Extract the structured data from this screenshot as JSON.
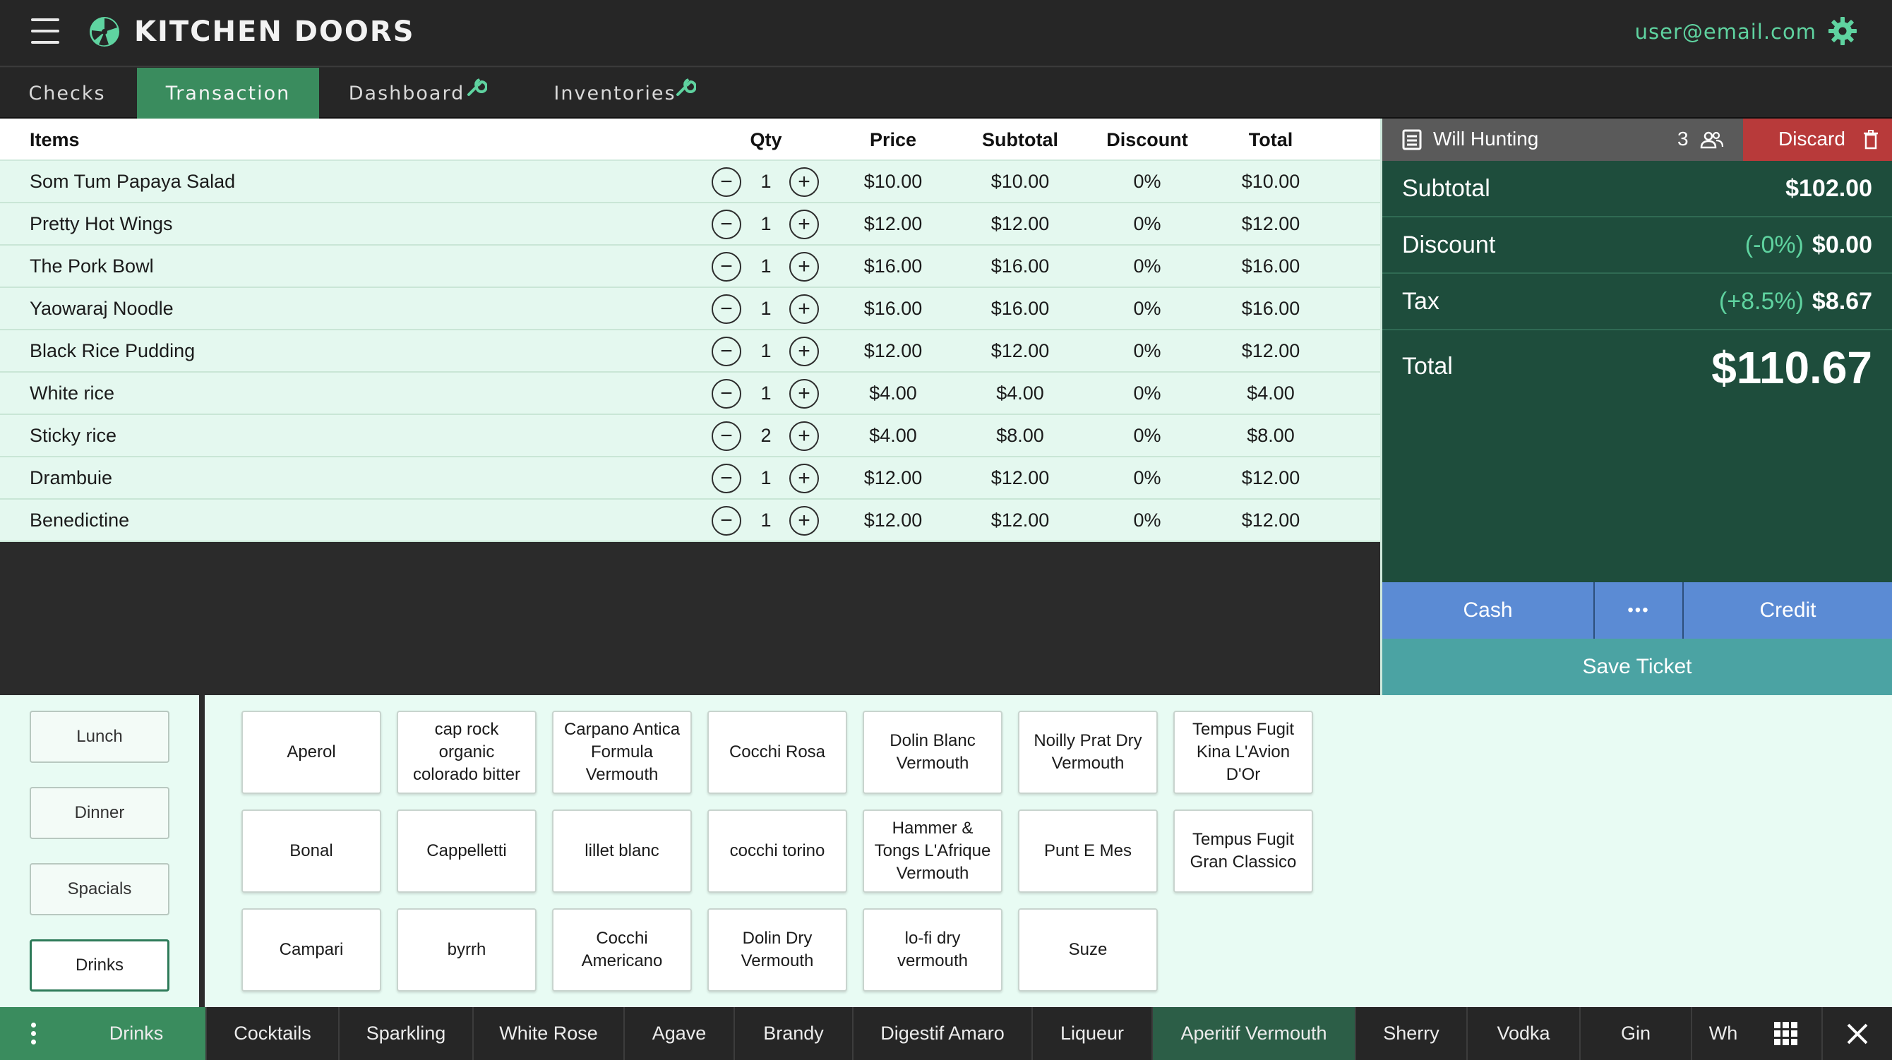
{
  "header": {
    "title": "KITCHEN DOORS",
    "user_email": "user@email.com"
  },
  "nav": {
    "tabs": [
      {
        "label": "Checks"
      },
      {
        "label": "Transaction"
      },
      {
        "label": "Dashboard"
      },
      {
        "label": "Inventories"
      }
    ],
    "active": "Transaction"
  },
  "table": {
    "headers": {
      "items": "Items",
      "qty": "Qty",
      "price": "Price",
      "subtotal": "Subtotal",
      "discount": "Discount",
      "total": "Total"
    },
    "rows": [
      {
        "name": "Som Tum Papaya Salad",
        "qty": "1",
        "price": "$10.00",
        "subtotal": "$10.00",
        "discount": "0%",
        "total": "$10.00"
      },
      {
        "name": "Pretty Hot Wings",
        "qty": "1",
        "price": "$12.00",
        "subtotal": "$12.00",
        "discount": "0%",
        "total": "$12.00"
      },
      {
        "name": "The Pork Bowl",
        "qty": "1",
        "price": "$16.00",
        "subtotal": "$16.00",
        "discount": "0%",
        "total": "$16.00"
      },
      {
        "name": "Yaowaraj Noodle",
        "qty": "1",
        "price": "$16.00",
        "subtotal": "$16.00",
        "discount": "0%",
        "total": "$16.00"
      },
      {
        "name": "Black Rice Pudding",
        "qty": "1",
        "price": "$12.00",
        "subtotal": "$12.00",
        "discount": "0%",
        "total": "$12.00"
      },
      {
        "name": "White rice",
        "qty": "1",
        "price": "$4.00",
        "subtotal": "$4.00",
        "discount": "0%",
        "total": "$4.00"
      },
      {
        "name": "Sticky rice",
        "qty": "2",
        "price": "$4.00",
        "subtotal": "$8.00",
        "discount": "0%",
        "total": "$8.00"
      },
      {
        "name": "Drambuie",
        "qty": "1",
        "price": "$12.00",
        "subtotal": "$12.00",
        "discount": "0%",
        "total": "$12.00"
      },
      {
        "name": "Benedictine",
        "qty": "1",
        "price": "$12.00",
        "subtotal": "$12.00",
        "discount": "0%",
        "total": "$12.00"
      }
    ]
  },
  "ticket": {
    "customer": "Will Hunting",
    "guests": "3",
    "discard_label": "Discard",
    "subtotal_label": "Subtotal",
    "subtotal_value": "$102.00",
    "discount_label": "Discount",
    "discount_pct": "(-0%)",
    "discount_value": "$0.00",
    "tax_label": "Tax",
    "tax_pct": "(+8.5%)",
    "tax_value": "$8.67",
    "total_label": "Total",
    "total_value": "$110.67",
    "cash_label": "Cash",
    "more_label": "•••",
    "credit_label": "Credit",
    "save_label": "Save Ticket"
  },
  "categories": [
    {
      "label": "Lunch"
    },
    {
      "label": "Dinner"
    },
    {
      "label": "Spacials"
    },
    {
      "label": "Drinks"
    }
  ],
  "active_category": "Drinks",
  "items": [
    [
      "Aperol",
      "cap rock organic colorado bitter",
      "Carpano Antica Formula Vermouth",
      "Cocchi Rosa",
      "Dolin Blanc Vermouth",
      "Noilly Prat Dry Vermouth",
      "Tempus Fugit Kina L'Avion D'Or"
    ],
    [
      "Bonal",
      "Cappelletti",
      "lillet blanc",
      "cocchi torino",
      "Hammer & Tongs L'Afrique Vermouth",
      "Punt E Mes",
      "Tempus Fugit Gran Classico"
    ],
    [
      "Campari",
      "byrrh",
      "Cocchi Americano",
      "Dolin Dry Vermouth",
      "lo-fi dry vermouth",
      "Suze"
    ]
  ],
  "bottom_tabs": [
    {
      "label": "Drinks"
    },
    {
      "label": "Cocktails"
    },
    {
      "label": "Sparkling"
    },
    {
      "label": "White Rose"
    },
    {
      "label": "Agave"
    },
    {
      "label": "Brandy"
    },
    {
      "label": "Digestif Amaro"
    },
    {
      "label": "Liqueur"
    },
    {
      "label": "Aperitif Vermouth"
    },
    {
      "label": "Sherry"
    },
    {
      "label": "Vodka"
    },
    {
      "label": "Gin"
    },
    {
      "label": "Wh"
    }
  ],
  "colors": {
    "brand_green": "#3a8c5e",
    "accent_mint": "#5fd3a0",
    "panel_dark_green": "#1e4d3c",
    "discard_red": "#b83a3a",
    "pay_blue": "#5b8bd4",
    "save_teal": "#4ba3a3"
  }
}
